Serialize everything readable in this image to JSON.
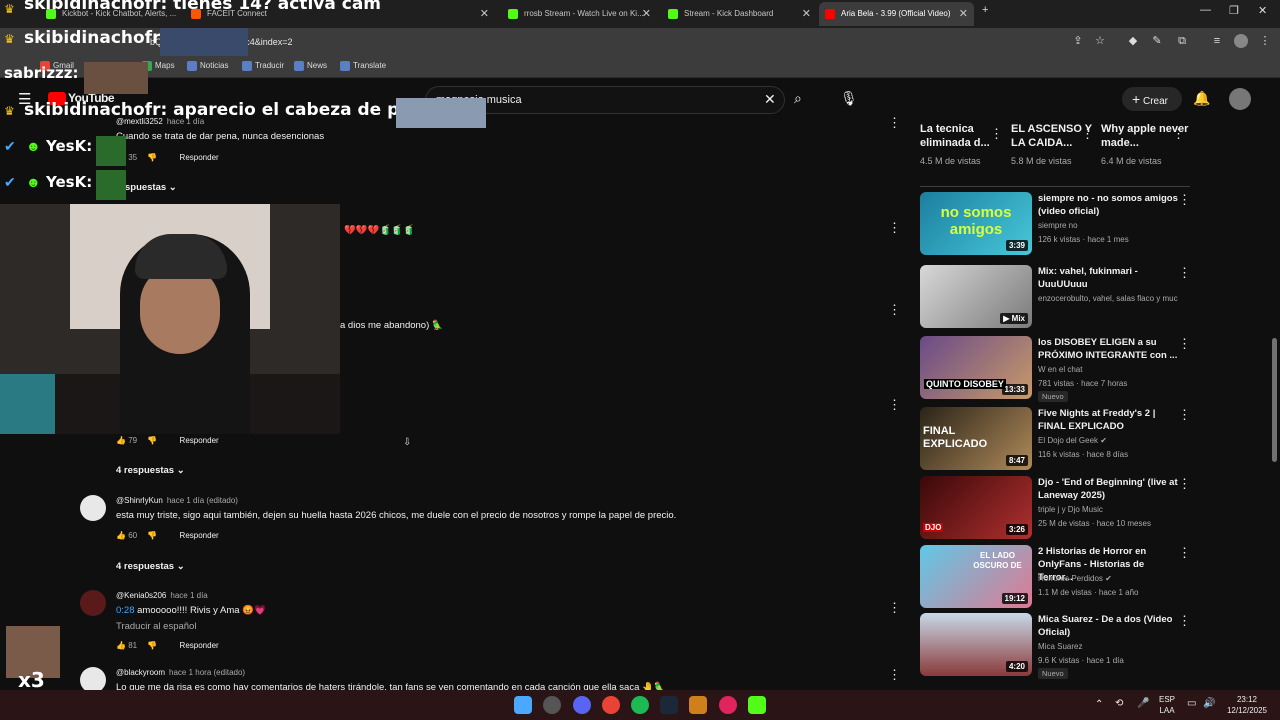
{
  "browser": {
    "tabs": [
      {
        "label": "Kickbot - Kick Chatbot, Alerts, ..."
      },
      {
        "label": "FACEIT Connect"
      },
      {
        "label": "rrosb Stream - Watch Live on Ki..."
      },
      {
        "label": "Stream - Kick Dashboard"
      },
      {
        "label": "Aria Bela - 3.99 (Official Video)"
      }
    ],
    "url": "bQ&list=RDo-SS8bRyGc4&index=2",
    "bookmarks": [
      "Gmail",
      "Maps",
      "Noticias",
      "Traducir",
      "News",
      "Translate"
    ]
  },
  "overlay": {
    "top_msg": "skibidinachofr: tienes 14? activa cam",
    "line2": "skibidinachofr",
    "line3": "sabrizzz:",
    "line4": "skibidinachofr: aparecio el cabeza de pingo",
    "yesk1": "YesK:",
    "yesk2": "YesK:",
    "combo": "x3"
  },
  "youtube": {
    "logo": "YouTube",
    "search_value": "magnesio musica",
    "create_label": "Crear"
  },
  "comments": [
    {
      "author": "@mextli3252",
      "time": "hace 1 día",
      "text": "Cuando se trata de dar pena,  nunca desencionas",
      "likes": "35",
      "reply": "Responder",
      "replies": "respuestas"
    },
    {
      "author": "",
      "time": "",
      "text": "💔💔💔🧃🧃🧃",
      "likes": "",
      "reply": "",
      "replies": ""
    },
    {
      "author": "",
      "time": "",
      "text": "a dios me abandono) 🦜",
      "likes": "79",
      "reply": "Responder",
      "replies": "4 respuestas"
    },
    {
      "author": "@ShinrlyKun",
      "time": "hace 1 día (editado)",
      "text": "esta muy triste, sigo aqui también, dejen su huella hasta 2026 chicos, me duele con el precio de nosotros y rompe la papel de precio.",
      "likes": "60",
      "reply": "Responder",
      "replies": "4 respuestas"
    },
    {
      "author": "@Kenia0s206",
      "time": "hace 1 día",
      "timestamp": "0:28",
      "text": " amooooo!!!! Rivis y Ama 😡💗",
      "translate": "Traducir al español",
      "likes": "81",
      "reply": "Responder"
    },
    {
      "author": "@blackyroom",
      "time": "hace 1 hora (editado)",
      "text": "Lo que me da risa es como hay comentarios de haters tirándole, tan fans se ven comentando en cada canción que ella saca 🤚🦜"
    }
  ],
  "chips": [
    {
      "title": "La tecnica eliminada d...",
      "views": "4.5 M de vistas"
    },
    {
      "title": "EL ASCENSO Y LA CAIDA...",
      "views": "5.8 M de vistas"
    },
    {
      "title": "Why apple never made...",
      "views": "6.4 M de vistas"
    }
  ],
  "recs": [
    {
      "title": "siempre no - no somos amigos (video oficial)",
      "channel": "siempre no",
      "meta": "126 k vistas · hace 1 mes",
      "duration": "3:39",
      "thumb_text": "no somos amigos",
      "badge": ""
    },
    {
      "title": "Mix: vahel, fukinmari - UuuUUuuu",
      "channel": "enzocerobulto, vahel, salas flaco y much...",
      "meta": "",
      "duration": "Mix",
      "thumb_text": "",
      "badge": ""
    },
    {
      "title": "los DISOBEY ELIGEN a su PRÓXIMO INTEGRANTE con ...",
      "channel": "W en el chat",
      "meta": "781 vistas · hace 7 horas",
      "duration": "13:33",
      "thumb_text": "QUINTO DISOBEY",
      "badge": "Nuevo"
    },
    {
      "title": "Five Nights at Freddy's 2 | FINAL EXPLICADO",
      "channel": "El Dojo del Geek",
      "meta": "116 k vistas · hace 8 días",
      "duration": "8:47",
      "thumb_text": "FINAL EXPLICADO",
      "badge": ""
    },
    {
      "title": "Djo - 'End of Beginning' (live at Laneway 2025)",
      "channel": "triple j y Djo Music",
      "meta": "25 M de vistas · hace 10 meses",
      "duration": "3:26",
      "thumb_text": "DJO",
      "badge": ""
    },
    {
      "title": "2 Historias de Horror en OnlyFans - Historias de Terror...",
      "channel": "Horrores Perdidos",
      "meta": "1.1 M de vistas · hace 1 año",
      "duration": "19:12",
      "thumb_text": "EL LADO OSCURO DE",
      "badge": ""
    },
    {
      "title": "Mica Suarez - De a dos (Video Oficial)",
      "channel": "Mica Suarez",
      "meta": "9.6 K vistas · hace 1 día",
      "duration": "4:20",
      "thumb_text": "",
      "badge": "Nuevo"
    }
  ],
  "taskbar": {
    "lang1": "ESP",
    "lang2": "LAA",
    "time": "23:12",
    "date": "12/12/2025"
  }
}
